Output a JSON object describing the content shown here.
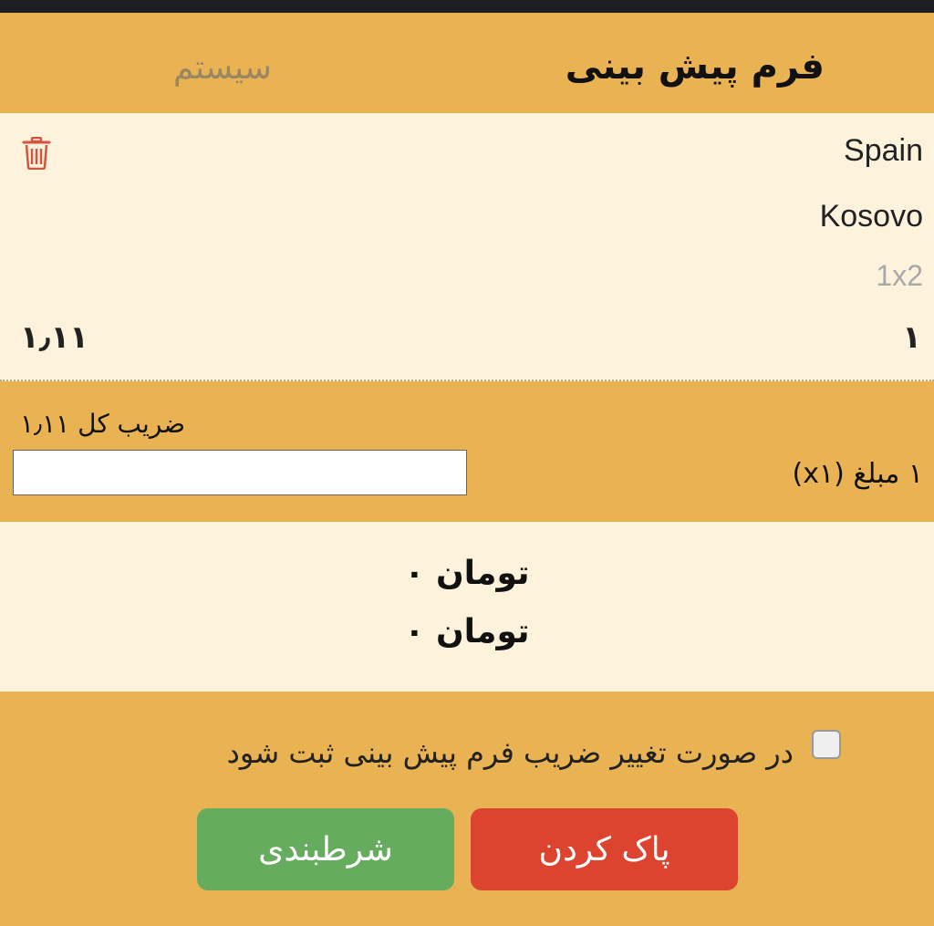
{
  "header": {
    "title": "فرم پیش بینی",
    "system_tab": "سیستم"
  },
  "bet": {
    "team_home": "Spain",
    "team_away": "Kosovo",
    "market": "1x2",
    "selection": "۱",
    "odds": "۱٫۱۱"
  },
  "stake": {
    "total_odds_label": "ضریب کل ۱٫۱۱",
    "amount_label": "۱ مبلغ (x۱)",
    "amount_value": ""
  },
  "totals": {
    "line1": "تومان ۰",
    "line2": "تومان ۰"
  },
  "footer": {
    "accept_label": "در صورت تغییر ضریب فرم پیش بینی ثبت شود",
    "accept_checked": false,
    "clear_button": "پاک کردن",
    "bet_button": "شرطبندی"
  },
  "colors": {
    "background": "#e9b354",
    "panel": "#fdf3dc",
    "clear_button": "#dc4430",
    "bet_button": "#65ac5e",
    "trash_icon": "#d3543f"
  }
}
